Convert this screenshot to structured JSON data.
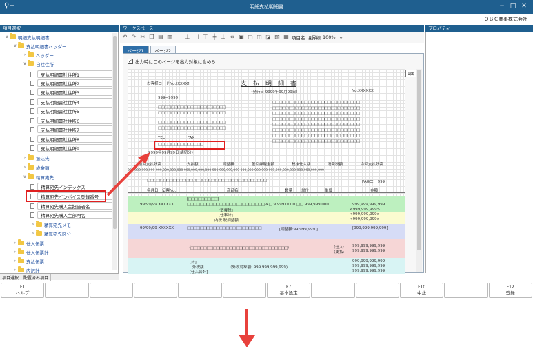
{
  "window": {
    "title": "明細支払明細書",
    "company": "ＯＢＣ商事株式会社"
  },
  "panes": {
    "left_title": "項目選択",
    "work_title": "ワークスペース",
    "prop_title": "プロパティ"
  },
  "tree": {
    "root": "明細支払明細書",
    "header_group": "支払明細書ヘッダー",
    "header": "ヘッダー",
    "own_address": "自社住所",
    "address_items": [
      "支払明細書社住所1",
      "支払明細書社住所2",
      "支払明細書社住所3",
      "支払明細書社住所4",
      "支払明細書社住所5",
      "支払明細書社住所6",
      "支払明細書社住所7",
      "支払明細書社住所8",
      "支払明細書社住所9"
    ],
    "transfer": "振込先",
    "amount": "歳金額",
    "settle": "精算宛先",
    "settle_items": [
      "精算宛先インデックス",
      "精算宛先インボイス登録番号",
      "精算宛先購入主担当者名",
      "精算宛先購入主部門名"
    ],
    "settle_memo": "精算宛先メモ",
    "settle_cls": "精算宛先区分",
    "purchase": "仕入伝票",
    "purchase_total": "仕入伝票計",
    "pay_slip": "支払伝票",
    "inner_total": "内訳計"
  },
  "left_tabs": [
    "項目選択",
    "配置済み項目"
  ],
  "toolbar": {
    "item_name": "項目名",
    "boundary": "境界線",
    "zoom": "100%"
  },
  "page_tabs": [
    "ページ1",
    "ページ2"
  ],
  "include_page": "出力時にこのページを出力対象に含める",
  "page_number_badge": "1面",
  "doc": {
    "customer_code": "お客様コードNo.[XXXX]",
    "title": "支　払　明　細　書",
    "issued": "（発行日 9999年99月99日）",
    "no": "No.XXXXXX",
    "zip": "999−9999",
    "tel_fax": "TEL　　　　　　FAX",
    "invoice_boxes": "□□□□□□□□□□□□□□",
    "period": "9999年99月99日 締切分）",
    "summary_headers": [
      "前回支払残高",
      "支払額",
      "調整額",
      "差引繰越金額",
      "税抜仕入額",
      "消費税額",
      "今回支払残高"
    ],
    "summary_values": "999,999,999,999 999,999,999,999 999,999,999,999 999,999,999,999 999,999,999,999 999,999,999,999 999,999,999,999",
    "page_label": "PAGE：　999",
    "detail_headers": [
      "年月日",
      "伝票No.",
      "商品名",
      "数量",
      "単位",
      "単価",
      "金額"
    ],
    "row_date": "99/99/99 XXXXXX",
    "row_qty": "※□ 9,999.0000 □□ 999,999.000",
    "row_amount": "999,999,999,999",
    "tax_lbl": "[消費税]",
    "adjust_lbl": "[仕事計]",
    "breakdown_lbl": "内税 税調整額",
    "paren_amounts": [
      "<999,999,999>",
      "<999,999,999>",
      "<999,999,999>"
    ],
    "adjust_note": "[調整額:99,999,999 ]",
    "adjust_amount": "[999,999,999,999]",
    "purchase_lbl": "（仕入:",
    "payment_lbl": "（支払:",
    "total_lbl": "[計]",
    "tax_excl": "外税額",
    "tax_target": "（外税対象額: 999,999,999,999)",
    "purchase_total_lbl": "[仕入合計]",
    "amount_plain": "999,999,999,999"
  },
  "fkeys": [
    {
      "key": "F1",
      "label": "ヘルプ"
    },
    {
      "key": "",
      "label": ""
    },
    {
      "key": "",
      "label": ""
    },
    {
      "key": "",
      "label": ""
    },
    {
      "key": "",
      "label": ""
    },
    {
      "key": "",
      "label": ""
    },
    {
      "key": "F7",
      "label": "基本設定"
    },
    {
      "key": "",
      "label": ""
    },
    {
      "key": "",
      "label": ""
    },
    {
      "key": "F10",
      "label": "中止"
    },
    {
      "key": "",
      "label": ""
    },
    {
      "key": "F12",
      "label": "登録"
    }
  ],
  "colors": {
    "titlebar": "#1f5f8f",
    "highlight": "#e02020",
    "band_green": "#bdf0bf",
    "band_blue": "#d6dcf6",
    "band_pink": "#f6d6d6",
    "band_cyan": "#d8f4f4",
    "band_yellow": "#fbfbd0"
  }
}
